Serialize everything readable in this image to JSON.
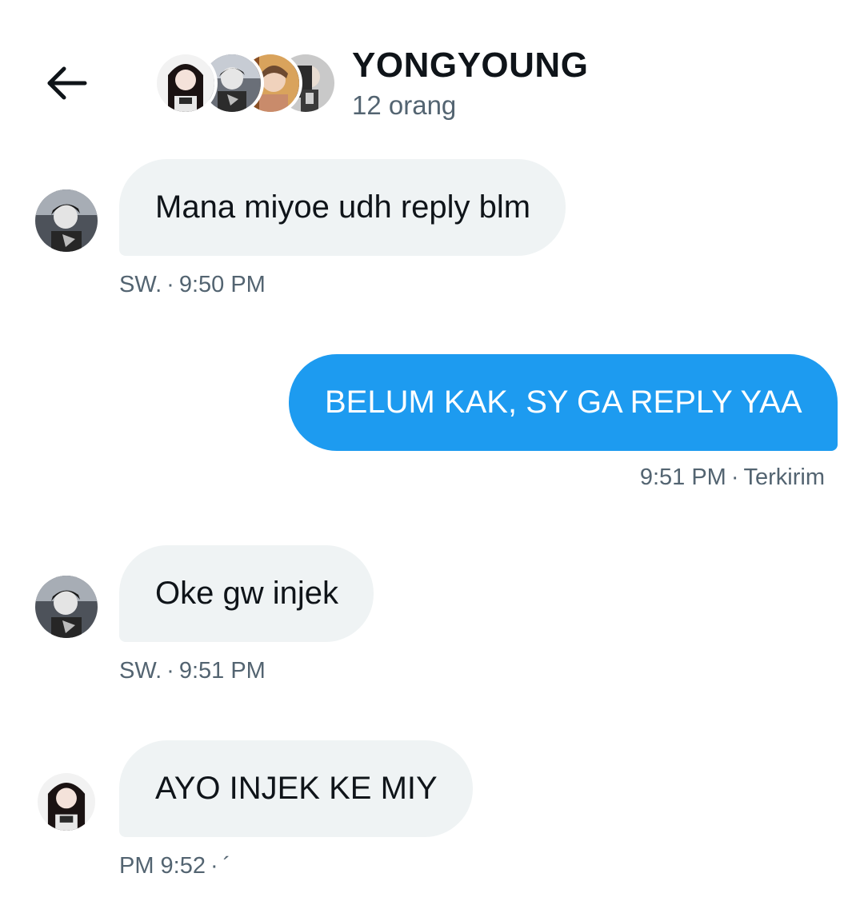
{
  "header": {
    "title": "YONGYOUNG",
    "subtitle": "12 orang",
    "back_icon": "arrow-left-icon",
    "participant_avatars": [
      "avatar-1",
      "avatar-2",
      "avatar-3",
      "avatar-4"
    ]
  },
  "messages": [
    {
      "direction": "incoming",
      "text": "Mana miyoe udh reply blm",
      "sender": "SW.",
      "time": "9:50 PM"
    },
    {
      "direction": "outgoing",
      "text": "BELUM KAK, SY GA REPLY YAA",
      "time": "9:51 PM",
      "status": "Terkirim"
    },
    {
      "direction": "incoming",
      "text": "Oke gw injek",
      "sender": "SW.",
      "time": "9:51 PM"
    },
    {
      "direction": "incoming",
      "text": "AYO INJEK KE MIY",
      "time": "PM 9:52",
      "trailing": "´"
    }
  ],
  "meta_separator": "·",
  "colors": {
    "outgoing_bubble": "#1d9bf0",
    "incoming_bubble": "#eff3f4",
    "meta_text": "#536471",
    "primary_text": "#0f1419"
  }
}
